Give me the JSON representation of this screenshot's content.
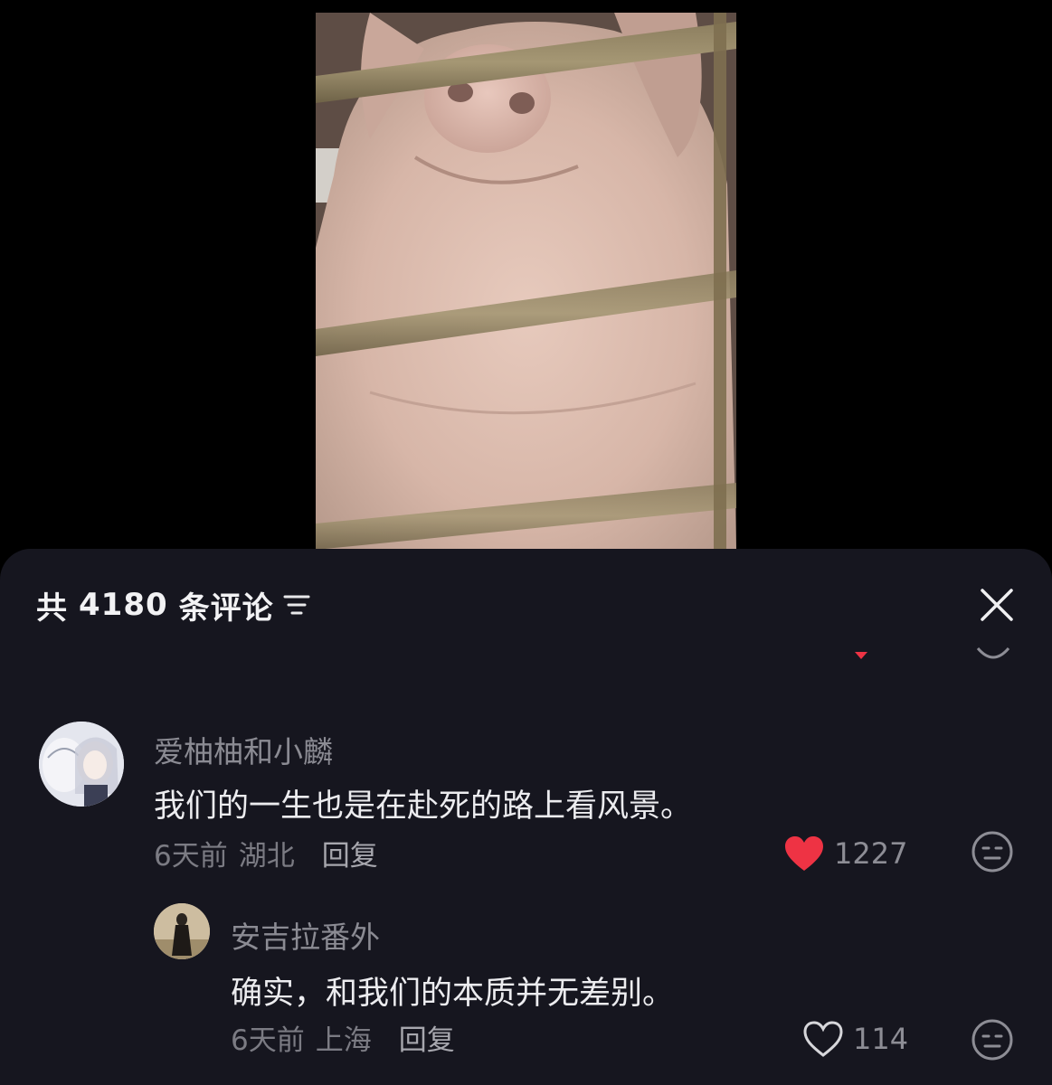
{
  "video": {
    "description_icon": "pig-behind-fence-image"
  },
  "comments_panel": {
    "header": {
      "prefix": "共",
      "count": "4180",
      "suffix": "条评论",
      "sort_icon": "filter-sort-icon",
      "close_icon": "close-icon"
    },
    "comments": [
      {
        "author": "爱柚柚和小麟",
        "text": "我们的一生也是在赴死的路上看风景。",
        "time": "6天前",
        "location": "湖北",
        "reply_label": "回复",
        "likes": "1227",
        "liked": true,
        "like_color": "#ee3344"
      }
    ],
    "replies": [
      {
        "author": "安吉拉番外",
        "text": "确实，和我们的本质并无差别。",
        "time": "6天前",
        "location": "上海",
        "reply_label": "回复",
        "likes": "114",
        "liked": false
      }
    ]
  }
}
